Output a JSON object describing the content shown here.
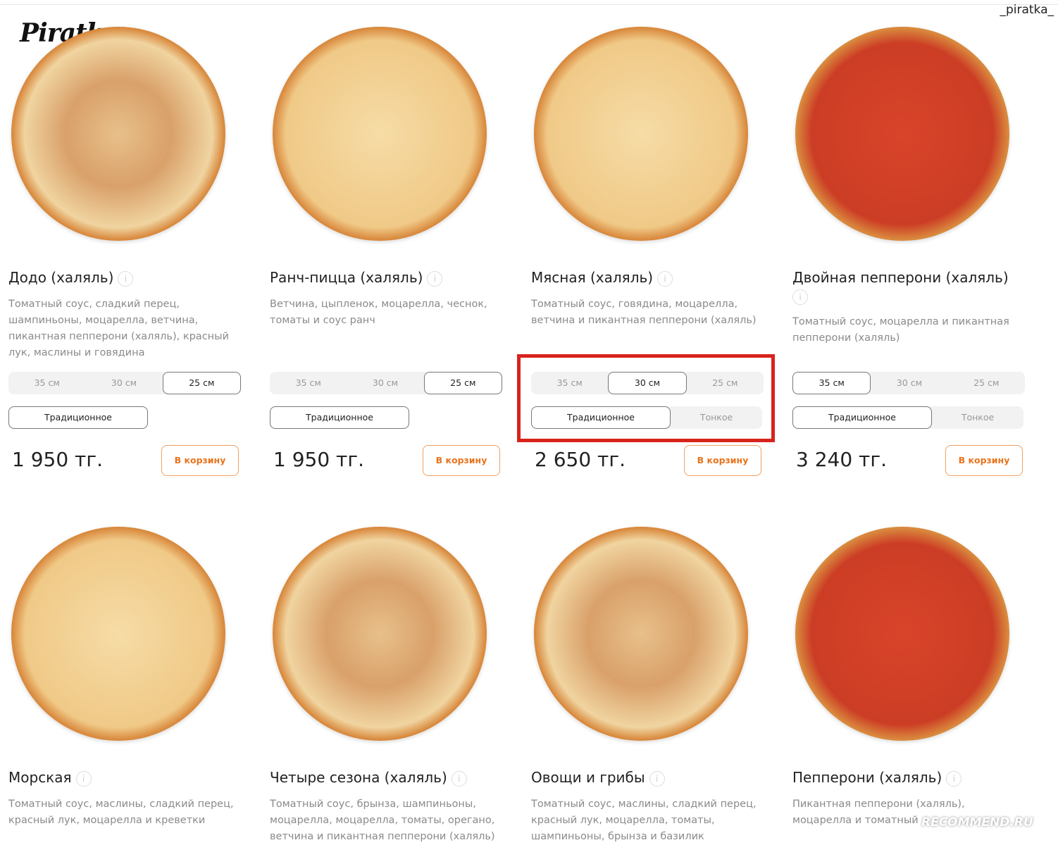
{
  "watermark_user": "_piratka_",
  "logo": "Piratka",
  "cart_label": "В корзину",
  "products": [
    {
      "name": "Додо (халяль)",
      "desc": "Томатный соус, сладкий перец, шампиньоны, моцарелла, ветчина, пикантная пепперони (халяль), красный лук, маслины и говядина",
      "sizes": [
        "35 см",
        "30 см",
        "25 см"
      ],
      "selected_size": "25 см",
      "crusts": [
        "Традиционное"
      ],
      "selected_crust": "Традиционное",
      "price": "1 950 тг."
    },
    {
      "name": "Ранч-пицца (халяль)",
      "desc": "Ветчина, цыпленок, моцарелла, чеснок, томаты и соус ранч",
      "sizes": [
        "35 см",
        "30 см",
        "25 см"
      ],
      "selected_size": "25 см",
      "crusts": [
        "Традиционное"
      ],
      "selected_crust": "Традиционное",
      "price": "1 950 тг."
    },
    {
      "name": "Мясная (халяль)",
      "desc": "Томатный соус, говядина, моцарелла, ветчина и пикантная пепперони (халяль)",
      "sizes": [
        "35 см",
        "30 см",
        "25 см"
      ],
      "selected_size": "30 см",
      "crusts": [
        "Традиционное",
        "Тонкое"
      ],
      "selected_crust": "Традиционное",
      "price": "2 650 тг.",
      "highlighted": true
    },
    {
      "name": "Двойная пепперони (халяль)",
      "desc": "Томатный соус, моцарелла и пикантная пепперони (халяль)",
      "sizes": [
        "35 см",
        "30 см",
        "25 см"
      ],
      "selected_size": "35 см",
      "crusts": [
        "Традиционное",
        "Тонкое"
      ],
      "selected_crust": "Традиционное",
      "price": "3 240 тг."
    },
    {
      "name": "Морская",
      "desc": "Томатный соус, маслины, сладкий перец, красный лук, моцарелла и креветки"
    },
    {
      "name": "Четыре сезона (халяль)",
      "desc": "Томатный соус, брынза, шампиньоны, моцарелла, моцарелла, томаты, орегано, ветчина и пикантная пепперони (халяль)"
    },
    {
      "name": "Овощи и грибы",
      "desc": "Томатный соус, маслины, сладкий перец, красный лук, моцарелла, томаты, шампиньоны, брынза и базилик"
    },
    {
      "name": "Пепперони (халяль)",
      "desc": "Пикантная пепперони (халяль), моцарелла и томатный"
    }
  ],
  "highlight_color": "#d8231d",
  "accent_color": "#e8741e",
  "site_watermark": "RECOMMEND.RU"
}
